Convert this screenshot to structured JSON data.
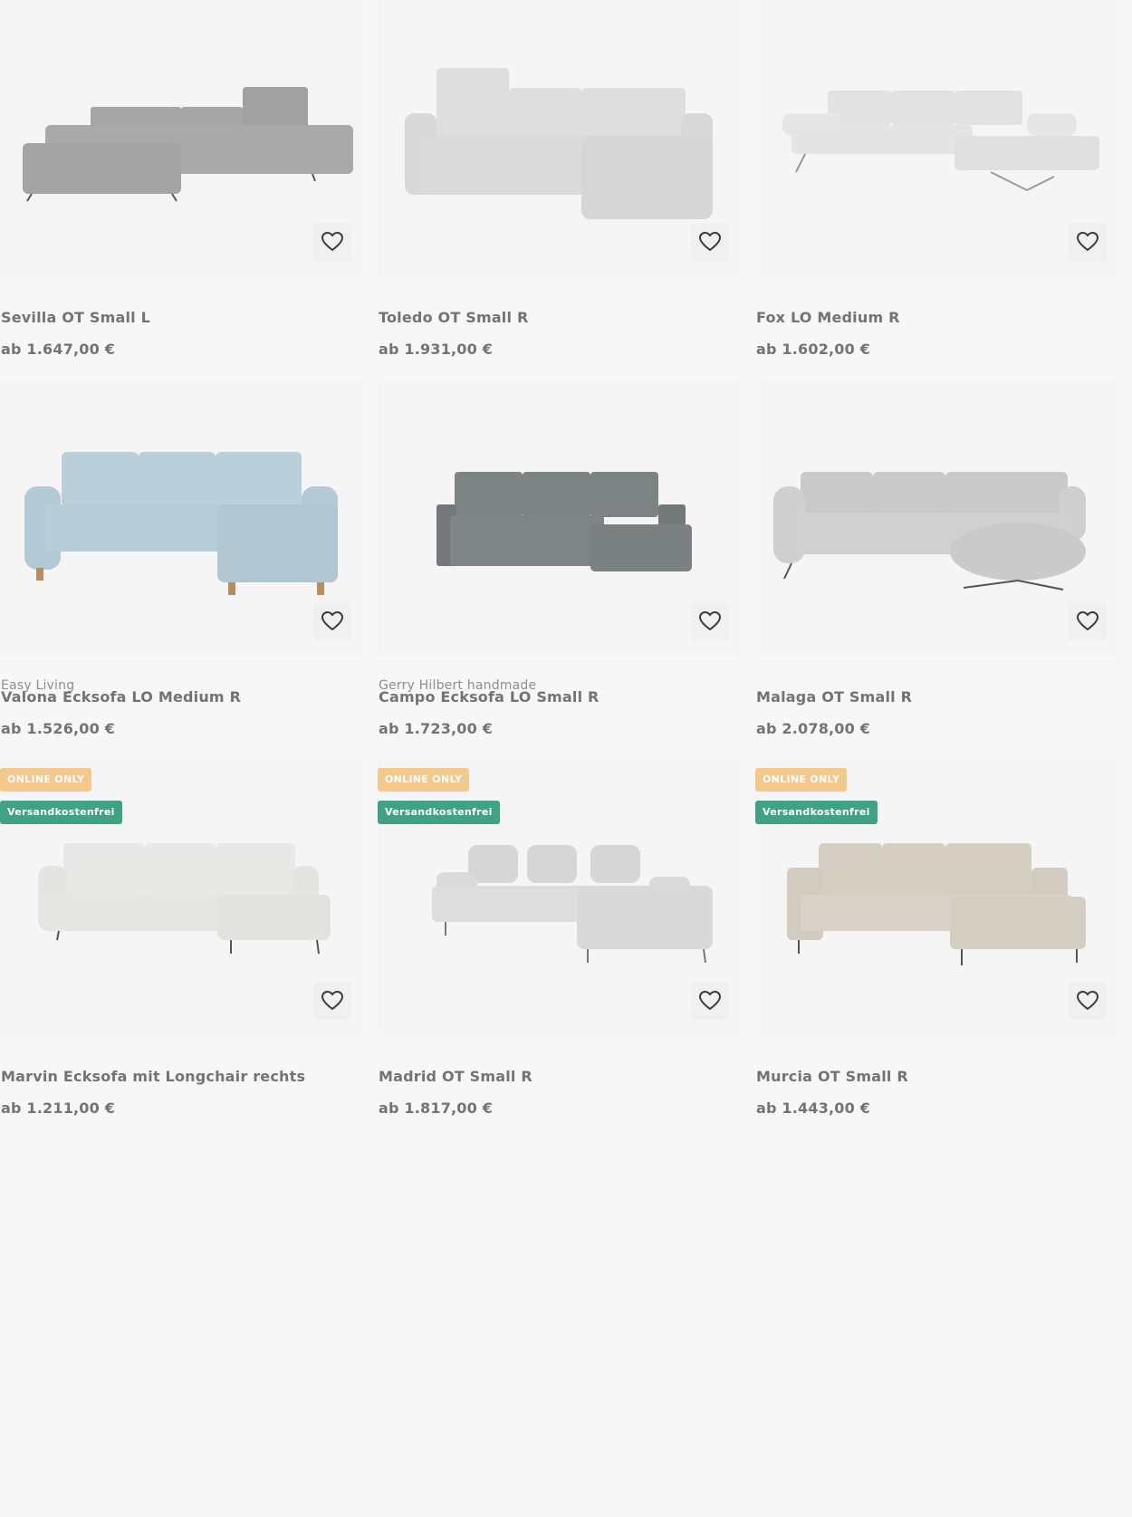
{
  "products": [
    {
      "brand": "",
      "name": "Sevilla OT Small L",
      "price": "ab 1.647,00 €",
      "badges": [],
      "color": "#a9a9a9"
    },
    {
      "brand": "",
      "name": "Toledo OT Small R",
      "price": "ab 1.931,00 €",
      "badges": [],
      "color": "#dcdcdc"
    },
    {
      "brand": "",
      "name": "Fox LO Medium R",
      "price": "ab 1.602,00 €",
      "badges": [],
      "color": "#e4e4e4"
    },
    {
      "brand": "Easy Living",
      "name": "Valona Ecksofa LO Medium R",
      "price": "ab 1.526,00 €",
      "badges": [],
      "color": "#b8cdd8"
    },
    {
      "brand": "Gerry Hilbert handmade",
      "name": "Campo Ecksofa LO Small R",
      "price": "ab 1.723,00 €",
      "badges": [],
      "color": "#7f8584"
    },
    {
      "brand": "",
      "name": "Malaga OT Small R",
      "price": "ab 2.078,00 €",
      "badges": [],
      "color": "#cfcfcf"
    },
    {
      "brand": "",
      "name": "Marvin Ecksofa mit Longchair rechts",
      "price": "ab 1.211,00 €",
      "badges": [
        "ONLINE ONLY",
        "Versandkostenfrei"
      ],
      "color": "#e6e6e4"
    },
    {
      "brand": "",
      "name": "Madrid OT Small R",
      "price": "ab 1.817,00 €",
      "badges": [
        "ONLINE ONLY",
        "Versandkostenfrei"
      ],
      "color": "#dddddd"
    },
    {
      "brand": "",
      "name": "Murcia OT Small R",
      "price": "ab 1.443,00 €",
      "badges": [
        "ONLINE ONLY",
        "Versandkostenfrei"
      ],
      "color": "#d7d1c8"
    }
  ],
  "icons": {
    "favorite": "heart-outline-icon"
  },
  "colors": {
    "online_badge": "#f4c88a",
    "shipping_badge": "#3fa284"
  }
}
